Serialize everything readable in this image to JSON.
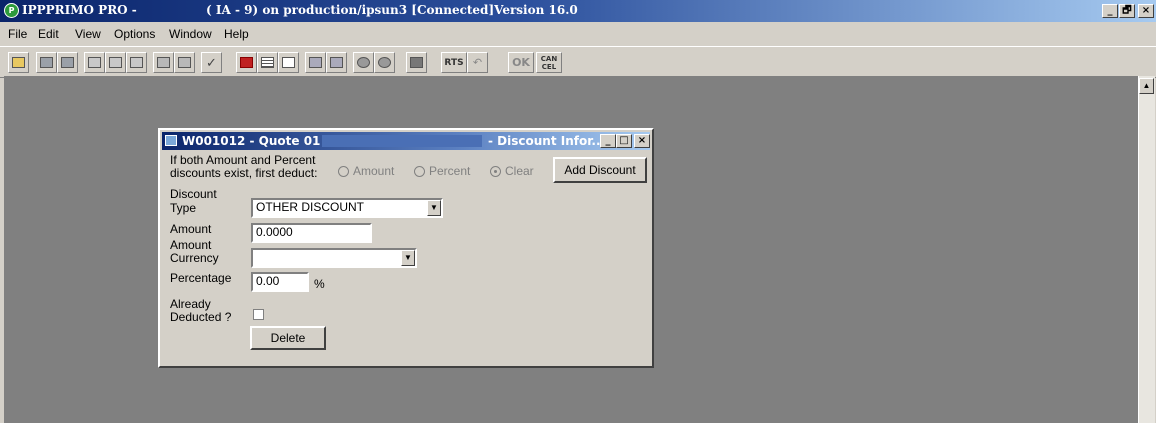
{
  "window": {
    "app_logo": "P",
    "app_name": "IPPPRIMO PRO -",
    "caption": "( IA - 9) on production/ipsun3 [Connected]Version 16.0",
    "minimize": "_",
    "restore": "🗗",
    "close": "×"
  },
  "menu": [
    "File",
    "Edit",
    "View",
    "Options",
    "Window",
    "Help"
  ],
  "toolbar": {
    "icons": [
      "open-folder-icon",
      "save-icon",
      "save-all-icon",
      "print-icon",
      "print-preview-icon",
      "print-setup-icon",
      "printer-icon",
      "printer-list-icon",
      "check-icon",
      "home-icon",
      "grid-icon",
      "calendar-icon",
      "find-icon",
      "find-next-icon",
      "gear-icon",
      "gears-icon",
      "trash-icon",
      "rts-icon",
      "undo-icon",
      "ok-icon",
      "cancel-icon"
    ],
    "rts_label": "RTS",
    "ok_label": "OK",
    "cancel_label": "CAN CEL"
  },
  "dialog": {
    "title": "W001012 - Quote 01 -",
    "title_right": "- Discount Infor...",
    "deduct_prompt_line1": "If both Amount and Percent",
    "deduct_prompt_line2": "discounts exist, first deduct:",
    "radio_amount": "Amount",
    "radio_percent": "Percent",
    "radio_clear": "Clear",
    "add_discount": "Add Discount",
    "discount_type_line1": "Discount",
    "discount_type_line2": "Type",
    "discount_type_value": "OTHER DISCOUNT",
    "amount_label": "Amount",
    "amount_value": "0.0000",
    "currency_line1": "Amount",
    "currency_line2": "Currency",
    "currency_value": "",
    "percentage_label": "Percentage",
    "percentage_value": "0.00",
    "percent_sign": "%",
    "already_line1": "Already",
    "already_line2": "Deducted ?",
    "delete": "Delete"
  }
}
